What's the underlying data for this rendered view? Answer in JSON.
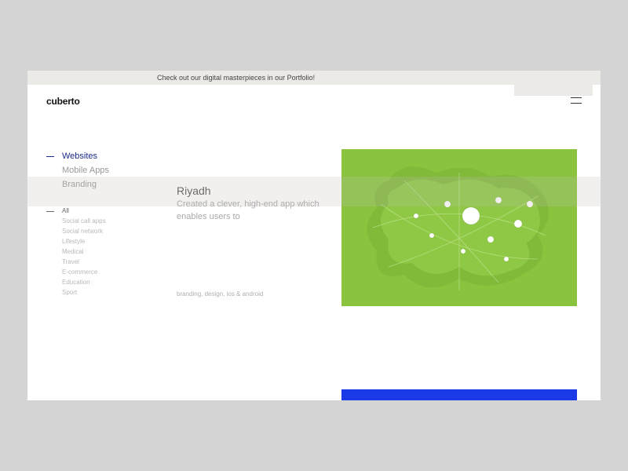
{
  "banner": {
    "text": "Check out our digital masterpieces in our Portfolio!"
  },
  "brand": {
    "logo": "cuberto"
  },
  "sidebar": {
    "primary": [
      {
        "label": "Websites",
        "active": true
      },
      {
        "label": "Mobile Apps",
        "active": false
      },
      {
        "label": "Branding",
        "active": false
      }
    ],
    "filters": [
      {
        "label": "All",
        "active": true
      },
      {
        "label": "Social call apps",
        "active": false
      },
      {
        "label": "Social network",
        "active": false
      },
      {
        "label": "Lifestyle",
        "active": false
      },
      {
        "label": "Medical",
        "active": false
      },
      {
        "label": "Travel",
        "active": false
      },
      {
        "label": "E-commerce",
        "active": false
      },
      {
        "label": "Education",
        "active": false
      },
      {
        "label": "Sport",
        "active": false
      }
    ]
  },
  "project": {
    "title": "Riyadh",
    "description": "Created a clever, high-end app which enables users to",
    "tags": "branding, design, ios & android"
  },
  "colors": {
    "accent_blue": "#1a3ae8",
    "map_green": "#8ac43f",
    "nav_active": "#1b2a8a"
  }
}
